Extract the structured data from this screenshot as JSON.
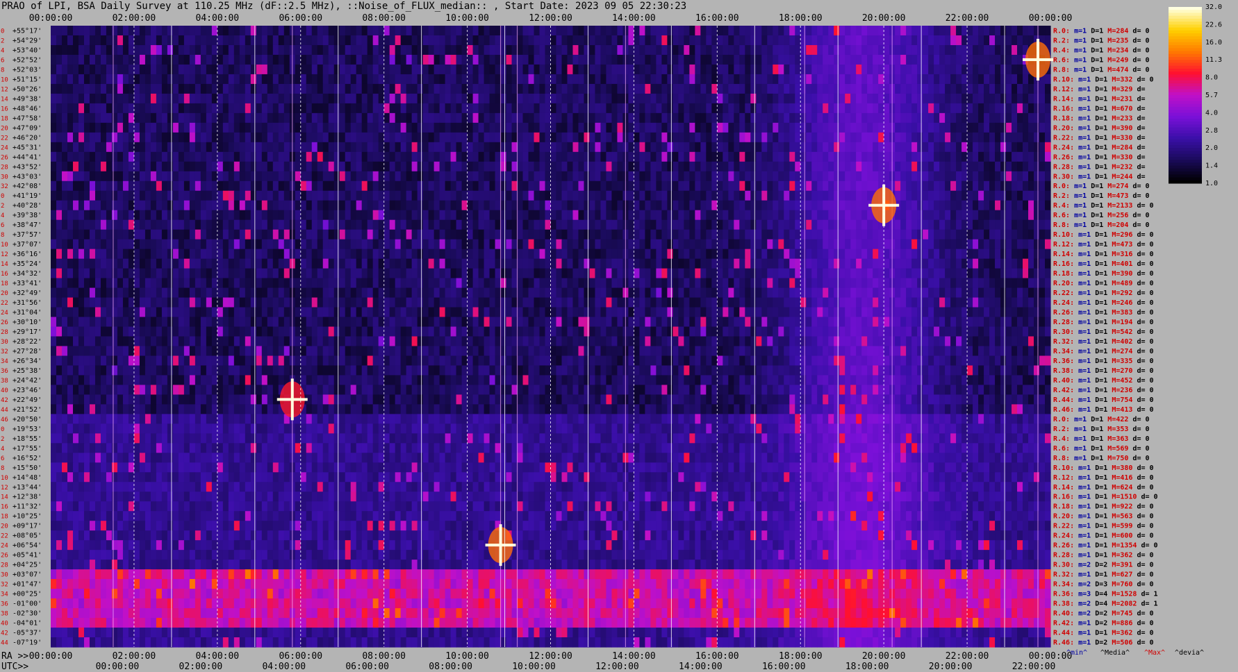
{
  "title": "PRAO of LPI, BSA Daily Survey at 110.25 MHz (dF::2.5 MHz), ::Noise_of_FLUX_median:: , Start Date: 2023 09 05 22:30:23",
  "chart_data": {
    "type": "heatmap",
    "title": "PRAO of LPI, BSA Daily Survey at 110.25 MHz (dF::2.5 MHz), ::Noise_of_FLUX_median:: , Start Date: 2023 09 05 22:30:23",
    "x_top_ticks": [
      "00:00:00",
      "02:00:00",
      "04:00:00",
      "06:00:00",
      "08:00:00",
      "10:00:00",
      "12:00:00",
      "14:00:00",
      "16:00:00",
      "18:00:00",
      "20:00:00",
      "22:00:00",
      "00:00:00"
    ],
    "x_ra_label": "RA >>",
    "x_ra_ticks": [
      "00:00:00",
      "02:00:00",
      "04:00:00",
      "06:00:00",
      "08:00:00",
      "10:00:00",
      "12:00:00",
      "14:00:00",
      "16:00:00",
      "18:00:00",
      "20:00:00",
      "22:00:00",
      "00:00:00"
    ],
    "x_utc_label": "UTC>>",
    "x_utc_ticks": [
      "00:00:00",
      "02:00:00",
      "04:00:00",
      "06:00:00",
      "08:00:00",
      "10:00:00",
      "12:00:00",
      "14:00:00",
      "16:00:00",
      "18:00:00",
      "20:00:00",
      "22:00:00"
    ],
    "y_labels": [
      "+55°17'",
      "+54°29'",
      "+53°40'",
      "+52°52'",
      "+52°03'",
      "+51°15'",
      "+50°26'",
      "+49°38'",
      "+48°46'",
      "+47°58'",
      "+47°09'",
      "+46°20'",
      "+45°31'",
      "+44°41'",
      "+43°52'",
      "+43°03'",
      "+42°08'",
      "+41°19'",
      "+40°28'",
      "+39°38'",
      "+38°47'",
      "+37°57'",
      "+37°07'",
      "+36°16'",
      "+35°24'",
      "+34°32'",
      "+33°41'",
      "+32°49'",
      "+31°56'",
      "+31°04'",
      "+30°10'",
      "+29°17'",
      "+28°22'",
      "+27°28'",
      "+26°34'",
      "+25°38'",
      "+24°42'",
      "+23°46'",
      "+22°49'",
      "+21°52'",
      "+20°50'",
      "+19°53'",
      "+18°55'",
      "+17°55'",
      "+16°52'",
      "+15°50'",
      "+14°48'",
      "+13°44'",
      "+12°38'",
      "+11°32'",
      "+10°25'",
      "+09°17'",
      "+08°05'",
      "+06°54'",
      "+05°41'",
      "+04°25'",
      "+03°07'",
      "+01°47'",
      "+00°25'",
      "-01°00'",
      "-02°30'",
      "-04°01'",
      "-05°37'",
      "-07°19'"
    ],
    "row_index": [
      "0",
      "2",
      "4",
      "6",
      "8",
      "10",
      "12",
      "14",
      "16",
      "18",
      "20",
      "22",
      "24",
      "26",
      "28",
      "30",
      "32",
      "0",
      "2",
      "4",
      "6",
      "8",
      "10",
      "12",
      "14",
      "16",
      "18",
      "20",
      "22",
      "24",
      "26",
      "28",
      "30",
      "32",
      "34",
      "36",
      "38",
      "40",
      "42",
      "44",
      "46",
      "0",
      "2",
      "4",
      "6",
      "8",
      "10",
      "12",
      "14",
      "16",
      "18",
      "20",
      "22",
      "24",
      "26",
      "28",
      "30",
      "32",
      "34",
      "36",
      "38",
      "40",
      "42",
      "44",
      "46"
    ],
    "row_stats": [
      "R.0: m=1 D=1 M=284 d= 0",
      "R.2: m=1 D=1 M=235 d= 0",
      "R.4: m=1 D=1 M=234 d= 0",
      "R.6: m=1 D=1 M=249 d= 0",
      "R.8: m=1 D=1 M=474 d= 0",
      "R.10: m=1 D=1 M=332 d= 0",
      "R.12: m=1 D=1 M=329 d=",
      "R.14: m=1 D=1 M=231 d=",
      "R.16: m=1 D=1 M=670 d=",
      "R.18: m=1 D=1 M=233 d=",
      "R.20: m=1 D=1 M=390 d=",
      "R.22: m=1 D=1 M=330 d=",
      "R.24: m=1 D=1 M=284 d=",
      "R.26: m=1 D=1 M=330 d=",
      "R.28: m=1 D=1 M=232 d=",
      "R.30: m=1 D=1 M=244 d=",
      "R.0: m=1 D=1 M=274 d= 0",
      "R.2: m=1 D=1 M=473 d= 0",
      "R.4: m=1 D=1 M=2133 d= 0",
      "R.6: m=1 D=1 M=256 d= 0",
      "R.8: m=1 D=1 M=204 d= 0",
      "R.10: m=1 D=1 M=296 d= 0",
      "R.12: m=1 D=1 M=473 d= 0",
      "R.14: m=1 D=1 M=316 d= 0",
      "R.16: m=1 D=1 M=401 d= 0",
      "R.18: m=1 D=1 M=390 d= 0",
      "R.20: m=1 D=1 M=489 d= 0",
      "R.22: m=1 D=1 M=292 d= 0",
      "R.24: m=1 D=1 M=246 d= 0",
      "R.26: m=1 D=1 M=383 d= 0",
      "R.28: m=1 D=1 M=194 d= 0",
      "R.30: m=1 D=1 M=542 d= 0",
      "R.32: m=1 D=1 M=402 d= 0",
      "R.34: m=1 D=1 M=274 d= 0",
      "R.36: m=1 D=1 M=335 d= 0",
      "R.38: m=1 D=1 M=270 d= 0",
      "R.40: m=1 D=1 M=452 d= 0",
      "R.42: m=1 D=1 M=236 d= 0",
      "R.44: m=1 D=1 M=754 d= 0",
      "R.46: m=1 D=1 M=413 d= 0",
      "R.0: m=1 D=1 M=422 d= 0",
      "R.2: m=1 D=1 M=353 d= 0",
      "R.4: m=1 D=1 M=363 d= 0",
      "R.6: m=1 D=1 M=569 d= 0",
      "R.8: m=1 D=1 M=750 d= 0",
      "R.10: m=1 D=1 M=380 d= 0",
      "R.12: m=1 D=1 M=416 d= 0",
      "R.14: m=1 D=1 M=624 d= 0",
      "R.16: m=1 D=1 M=1510 d= 0",
      "R.18: m=1 D=1 M=922 d= 0",
      "R.20: m=1 D=1 M=563 d= 0",
      "R.22: m=1 D=1 M=599 d= 0",
      "R.24: m=1 D=1 M=600 d= 0",
      "R.26: m=1 D=1 M=1354 d= 0",
      "R.28: m=1 D=1 M=362 d= 0",
      "R.30: m=2 D=2 M=391 d= 0",
      "R.32: m=1 D=1 M=627 d= 0",
      "R.34: m=2 D=3 M=760 d= 0",
      "R.36: m=3 D=4 M=1528 d= 1",
      "R.38: m=2 D=4 M=2082 d= 1",
      "R.40: m=2 D=2 M=745 d= 0",
      "R.42: m=1 D=2 M=886 d= 0",
      "R.44: m=1 D=1 M=362 d= 0",
      "R.46: m=1 D=2 M=506 d= 0"
    ],
    "stats_footer": [
      "^min^",
      "^Media^",
      "^Max^",
      "^devia^"
    ],
    "colorbar_ticks": [
      "32.0",
      "22.6",
      "16.0",
      "11.3",
      "8.0",
      "5.7",
      "4.0",
      "2.8",
      "2.0",
      "1.4",
      "1.0"
    ],
    "colorbar_range": [
      1.0,
      32.0
    ],
    "colorbar_scale": "log",
    "colormap": [
      "#000000",
      "#1a0b5a",
      "#3a0fa8",
      "#7a10d8",
      "#c010c8",
      "#ff1030",
      "#ff7a00",
      "#ffd000",
      "#ffffe0"
    ],
    "hot_ra_hours": [
      1.5,
      5.8,
      10.8,
      11.2,
      13.8,
      18.1,
      20.2,
      23.7
    ],
    "strong_sources": [
      {
        "ra_hours": 20.0,
        "dec": "+40°28'",
        "level": 32.0
      },
      {
        "ra_hours": 10.8,
        "dec": "+06°54'",
        "level": 32.0
      },
      {
        "ra_hours": 23.7,
        "dec": "+52°52'",
        "level": 32.0
      },
      {
        "ra_hours": 5.8,
        "dec": "+22°49'",
        "level": 22.6
      }
    ]
  }
}
